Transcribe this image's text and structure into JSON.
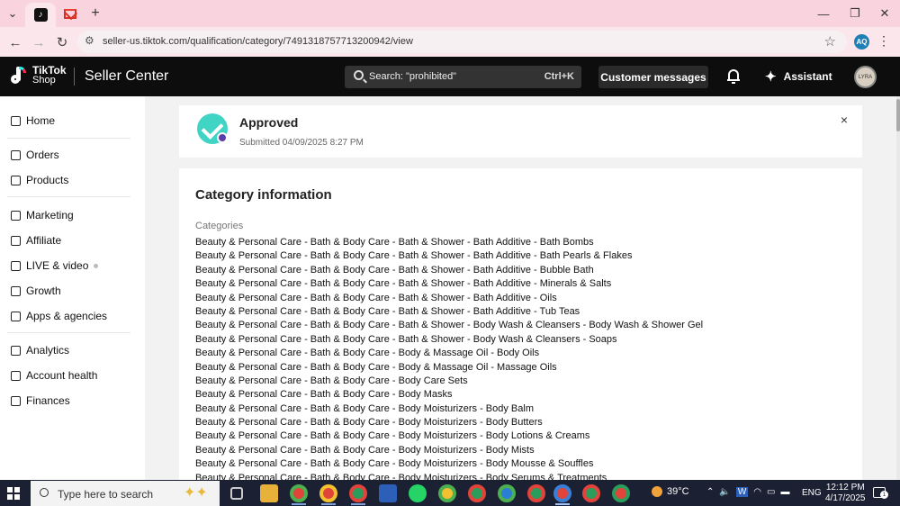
{
  "browser": {
    "active_tab_icon": "tiktok-shop-favicon",
    "second_tab_icon": "gmail-favicon",
    "new_tab_label": "+",
    "url": "seller-us.tiktok.com/qualification/category/7491318757713200942/view",
    "profile_initials": "AQ"
  },
  "header": {
    "logo_line1": "TikTok",
    "logo_line2": "Shop",
    "title": "Seller Center",
    "search_placeholder": "Search: \"prohibited\"",
    "search_shortcut": "Ctrl+K",
    "customer_messages": "Customer messages",
    "assistant": "Assistant",
    "avatar_text": "LYRA"
  },
  "sidebar": {
    "items": [
      {
        "label": "Home",
        "icon": "home-icon"
      },
      {
        "label": "Orders",
        "icon": "orders-icon"
      },
      {
        "label": "Products",
        "icon": "products-icon"
      },
      {
        "label": "Marketing",
        "icon": "megaphone-icon"
      },
      {
        "label": "Affiliate",
        "icon": "people-icon"
      },
      {
        "label": "LIVE & video",
        "icon": "video-icon"
      },
      {
        "label": "Growth",
        "icon": "growth-icon"
      },
      {
        "label": "Apps & agencies",
        "icon": "apps-icon"
      },
      {
        "label": "Analytics",
        "icon": "chart-icon"
      },
      {
        "label": "Account health",
        "icon": "bulb-icon"
      },
      {
        "label": "Finances",
        "icon": "wallet-icon"
      }
    ]
  },
  "status": {
    "title": "Approved",
    "submitted": "Submitted 04/09/2025 8:27 PM",
    "close": "×"
  },
  "category_info": {
    "title": "Category information",
    "categories_label": "Categories",
    "categories": [
      "Beauty & Personal Care - Bath & Body Care - Bath & Shower - Bath Additive - Bath Bombs",
      "Beauty & Personal Care - Bath & Body Care - Bath & Shower - Bath Additive - Bath Pearls & Flakes",
      "Beauty & Personal Care - Bath & Body Care - Bath & Shower - Bath Additive - Bubble Bath",
      "Beauty & Personal Care - Bath & Body Care - Bath & Shower - Bath Additive - Minerals & Salts",
      "Beauty & Personal Care - Bath & Body Care - Bath & Shower - Bath Additive - Oils",
      "Beauty & Personal Care - Bath & Body Care - Bath & Shower - Bath Additive - Tub Teas",
      "Beauty & Personal Care - Bath & Body Care - Bath & Shower - Body Wash & Cleansers - Body Wash & Shower Gel",
      "Beauty & Personal Care - Bath & Body Care - Bath & Shower - Body Wash & Cleansers - Soaps",
      "Beauty & Personal Care - Bath & Body Care - Body & Massage Oil - Body Oils",
      "Beauty & Personal Care - Bath & Body Care - Body & Massage Oil - Massage Oils",
      "Beauty & Personal Care - Bath & Body Care - Body Care Sets",
      "Beauty & Personal Care - Bath & Body Care - Body Masks",
      "Beauty & Personal Care - Bath & Body Care - Body Moisturizers - Body Balm",
      "Beauty & Personal Care - Bath & Body Care - Body Moisturizers - Body Butters",
      "Beauty & Personal Care - Bath & Body Care - Body Moisturizers - Body Lotions & Creams",
      "Beauty & Personal Care - Bath & Body Care - Body Moisturizers - Body Mists",
      "Beauty & Personal Care - Bath & Body Care - Body Moisturizers - Body Mousse & Souffles",
      "Beauty & Personal Care - Bath & Body Care - Body Moisturizers - Body Serums & Treatments"
    ]
  },
  "taskbar": {
    "search_placeholder": "Type here to search",
    "weather": "39°C",
    "language": "ENG",
    "time": "12:12 PM",
    "date": "4/17/2025",
    "notification_count": "1"
  }
}
